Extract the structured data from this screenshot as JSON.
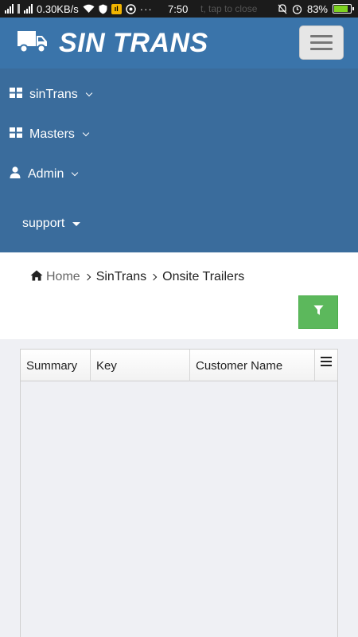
{
  "status_bar": {
    "network_speed": "0.30KB/s",
    "time": "7:50",
    "notification_ghost": "t, tap to close",
    "battery_percent": "83%",
    "battery_level": 0.83
  },
  "header": {
    "app_title": "SIN TRANS"
  },
  "nav": {
    "items": [
      {
        "label": "sinTrans",
        "icon": "grid-icon"
      },
      {
        "label": "Masters",
        "icon": "grid-icon"
      },
      {
        "label": "Admin",
        "icon": "user-icon"
      }
    ],
    "support_label": "support"
  },
  "breadcrumb": {
    "home": "Home",
    "section": "SinTrans",
    "current": "Onsite Trailers"
  },
  "grid": {
    "columns": [
      "Summary",
      "Key",
      "Customer Name"
    ]
  },
  "colors": {
    "header_bg": "#3a74aa",
    "nav_bg": "#3a6c9c",
    "filter_button": "#5cb85c"
  }
}
